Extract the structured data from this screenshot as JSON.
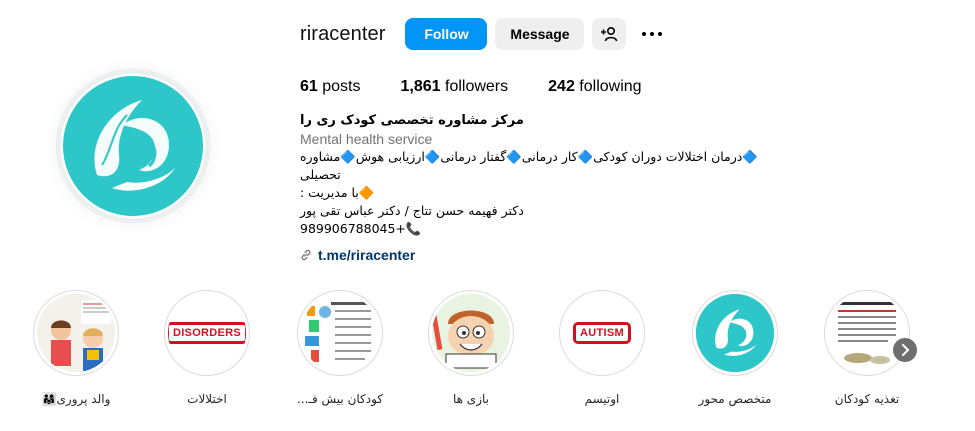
{
  "colors": {
    "accent": "#0095f6",
    "brand_teal": "#2ec7c9",
    "badge_red": "#d1121e",
    "link": "#00376b"
  },
  "profile": {
    "username": "riracenter",
    "follow_label": "Follow",
    "message_label": "Message",
    "add_user_icon": "add-user-icon",
    "more_icon": "more-options-icon"
  },
  "stats": {
    "posts_count": "61",
    "posts_label": "posts",
    "followers_count": "1,861",
    "followers_label": "followers",
    "following_count": "242",
    "following_label": "following"
  },
  "bio": {
    "name": "مرکز مشاوره تخصصی کودک ری را",
    "category": "Mental health service",
    "line1": "🔷درمان اختلالات دوران کودکی🔷کار درمانی🔷گفتار درمانی🔷ارزیابی هوش🔷مشاوره تحصیلی",
    "line2": "🔶با مدیریت :",
    "line3": "دکتر فهیمه حسن تتاج / دکتر عباس تقی پور",
    "phone": "989906788045+",
    "phone_icon": "📞",
    "link": "t.me/riracenter"
  },
  "highlights": [
    {
      "label": "والد پروری👨‍👩‍👧",
      "kind": "kids-photo"
    },
    {
      "label": "اختلالات",
      "kind": "badge",
      "badge_text": "DISORDERS"
    },
    {
      "label": "کودکان بیش فـ...",
      "kind": "hyperactive"
    },
    {
      "label": "بازی ها",
      "kind": "cartoon"
    },
    {
      "label": "اوتیسم",
      "kind": "badge",
      "badge_text": "AUTISM"
    },
    {
      "label": "متخصص محور",
      "kind": "logo"
    },
    {
      "label": "تغذیه کودکان",
      "kind": "document"
    }
  ]
}
